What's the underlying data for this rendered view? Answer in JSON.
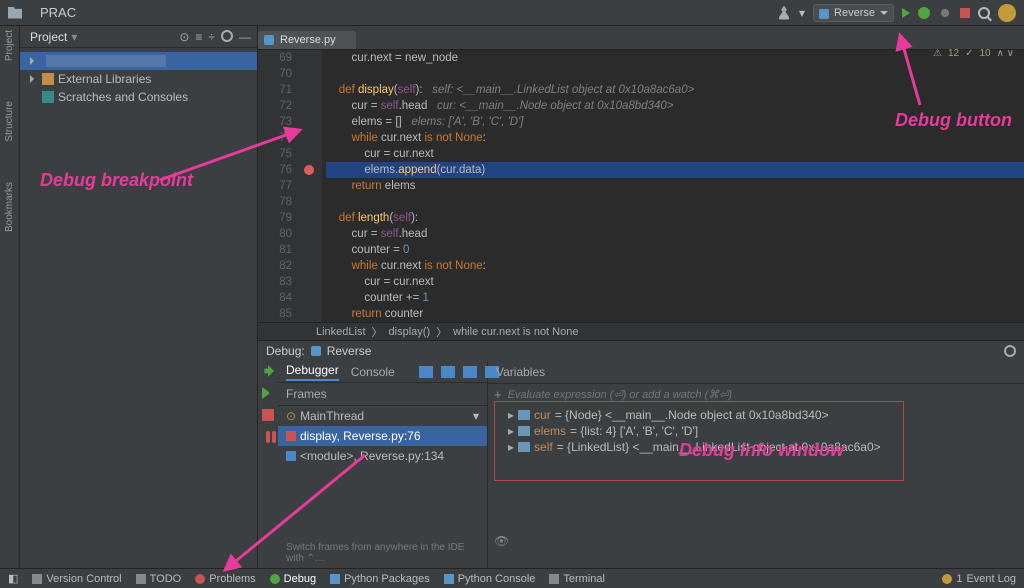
{
  "window": {
    "title": "PRAC"
  },
  "toolbar": {
    "run_config": "Reverse",
    "icons": [
      "person-icon",
      "play-icon",
      "bug-icon",
      "rerun-icon",
      "stop-icon",
      "search-icon",
      "avatar"
    ]
  },
  "project_panel": {
    "header": "Project",
    "items": [
      {
        "label": "",
        "selected": true
      },
      {
        "label": "External Libraries"
      },
      {
        "label": "Scratches and Consoles"
      }
    ]
  },
  "left_tool_windows": [
    "Project",
    "Structure",
    "Bookmarks"
  ],
  "editor": {
    "tab": "Reverse.py",
    "status_warnings": "12",
    "status_weak": "10",
    "breadcrumbs": [
      "LinkedList",
      "display()",
      "while cur.next is not None"
    ],
    "breakpoint_line": 76,
    "lines": [
      {
        "n": 69,
        "code": "        cur.next = new_node"
      },
      {
        "n": 70,
        "code": ""
      },
      {
        "n": 71,
        "code": "    def display(self):   self: <__main__.LinkedList object at 0x10a8ac6a0>"
      },
      {
        "n": 72,
        "code": "        cur = self.head   cur: <__main__.Node object at 0x10a8bd340>"
      },
      {
        "n": 73,
        "code": "        elems = []   elems: ['A', 'B', 'C', 'D']"
      },
      {
        "n": 74,
        "code": "        while cur.next is not None:"
      },
      {
        "n": 75,
        "code": "            cur = cur.next"
      },
      {
        "n": 76,
        "code": "            elems.append(cur.data)",
        "hl": true
      },
      {
        "n": 77,
        "code": "        return elems"
      },
      {
        "n": 78,
        "code": ""
      },
      {
        "n": 79,
        "code": "    def length(self):"
      },
      {
        "n": 80,
        "code": "        cur = self.head"
      },
      {
        "n": 81,
        "code": "        counter = 0"
      },
      {
        "n": 82,
        "code": "        while cur.next is not None:"
      },
      {
        "n": 83,
        "code": "            cur = cur.next"
      },
      {
        "n": 84,
        "code": "            counter += 1"
      },
      {
        "n": 85,
        "code": "        return counter"
      }
    ]
  },
  "debug": {
    "title": "Debug:",
    "config": "Reverse",
    "tabs": {
      "debugger": "Debugger",
      "console": "Console"
    },
    "frames_label": "Frames",
    "variables_label": "Variables",
    "eval_placeholder": "Evaluate expression (⏎) or add a watch (⌘⏎)",
    "thread": "MainThread",
    "frames": [
      {
        "label": "display, Reverse.py:76",
        "selected": true
      },
      {
        "label": "<module>, Reverse.py:134"
      }
    ],
    "frames_hint": "Switch frames from anywhere in the IDE with ⌃…",
    "variables": [
      {
        "name": "cur",
        "value": "= {Node} <__main__.Node object at 0x10a8bd340>"
      },
      {
        "name": "elems",
        "value": "= {list: 4} ['A', 'B', 'C', 'D']"
      },
      {
        "name": "self",
        "value": "= {LinkedList} <__main__.LinkedList object at 0x10a8ac6a0>"
      }
    ]
  },
  "statusbar": {
    "items": [
      "Version Control",
      "TODO",
      "Problems",
      "Debug",
      "Python Packages",
      "Python Console",
      "Terminal"
    ],
    "event_log": "Event Log",
    "event_count": "1",
    "active": "Debug"
  },
  "annotations": {
    "breakpoint": "Debug breakpoint",
    "button": "Debug button",
    "info": "Debug info window"
  }
}
